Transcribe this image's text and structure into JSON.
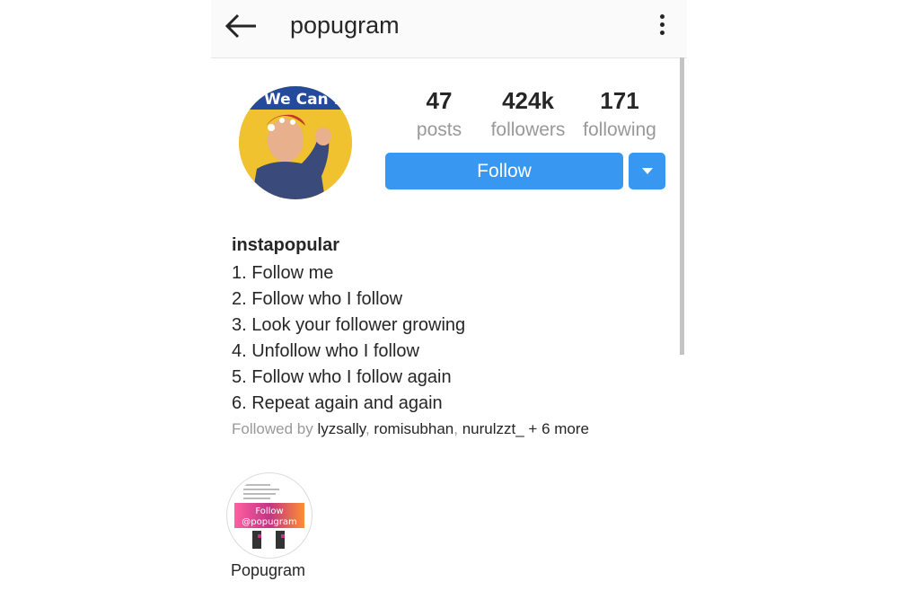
{
  "appbar": {
    "title": "popugram",
    "back_icon": "arrow-left-icon",
    "more_icon": "more-vertical-icon"
  },
  "profile": {
    "avatar_text": "We Can Do It!",
    "stats": [
      {
        "value": "47",
        "label": "posts"
      },
      {
        "value": "424k",
        "label": "followers"
      },
      {
        "value": "171",
        "label": "following"
      }
    ],
    "follow_label": "Follow",
    "username": "instapopular",
    "bio": [
      "1. Follow me",
      "2. Follow who I  follow",
      "3. Look your follower growing",
      "4. Unfollow who I follow",
      "5. Follow who I follow again",
      "6. Repeat again and again"
    ],
    "followed_by": {
      "prefix": "Followed by ",
      "users": [
        "lyzsally",
        "romisubhan",
        "nurulzzt_"
      ],
      "sep": ", ",
      "more": "+ 6 more"
    }
  },
  "highlight": {
    "label": "Popugram",
    "badge_line1": "Follow",
    "badge_line2": "@popugram"
  },
  "colors": {
    "accent": "#3897f0",
    "muted": "#999999",
    "text": "#262626"
  }
}
